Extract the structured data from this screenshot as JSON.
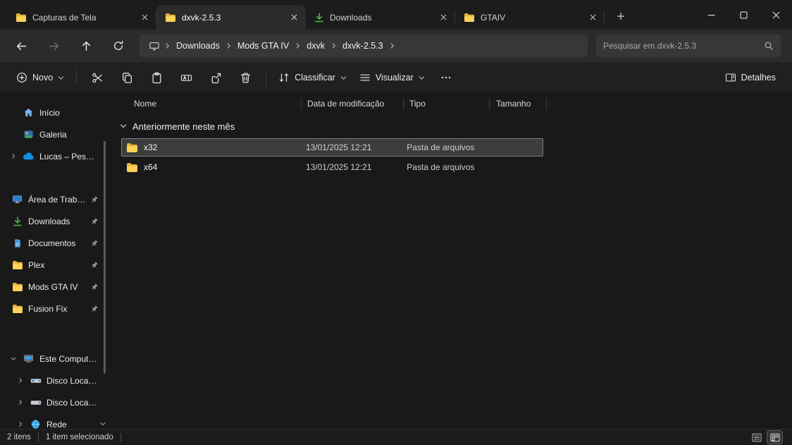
{
  "tabs": [
    {
      "label": "Capturas de Tela",
      "icon": "folder-icon"
    },
    {
      "label": "dxvk-2.5.3",
      "icon": "folder-icon",
      "active": true
    },
    {
      "label": "Downloads",
      "icon": "download-icon"
    },
    {
      "label": "GTAIV",
      "icon": "folder-icon"
    }
  ],
  "navigation": {
    "breadcrumb": [
      "Downloads",
      "Mods GTA IV",
      "dxvk",
      "dxvk-2.5.3"
    ],
    "search_placeholder": "Pesquisar em dxvk-2.5.3"
  },
  "toolbar": {
    "new_label": "Novo",
    "sort_label": "Classificar",
    "view_label": "Visualizar",
    "details_label": "Detalhes"
  },
  "sidebar": {
    "items": [
      {
        "label": "Início",
        "icon": "home-icon"
      },
      {
        "label": "Galeria",
        "icon": "gallery-icon"
      },
      {
        "label": "Lucas – Pessoal",
        "icon": "onedrive-cloud-icon"
      },
      {
        "label": "Área de Trabalho",
        "icon": "desktop-icon",
        "pinned": true
      },
      {
        "label": "Downloads",
        "icon": "download-icon",
        "pinned": true
      },
      {
        "label": "Documentos",
        "icon": "document-icon",
        "pinned": true
      },
      {
        "label": "Plex",
        "icon": "folder-icon",
        "pinned": true
      },
      {
        "label": "Mods GTA IV",
        "icon": "folder-icon",
        "pinned": true
      },
      {
        "label": "Fusion Fix",
        "icon": "folder-icon",
        "pinned": true
      },
      {
        "label": "Este Computador",
        "icon": "computer-icon"
      },
      {
        "label": "Disco Local (C:)",
        "icon": "drive-windows-icon"
      },
      {
        "label": "Disco Local (D:)",
        "icon": "drive-icon"
      },
      {
        "label": "Rede",
        "icon": "network-icon"
      }
    ]
  },
  "files": {
    "columns": [
      "Nome",
      "Data de modificação",
      "Tipo",
      "Tamanho"
    ],
    "group_label": "Anteriormente neste mês",
    "rows": [
      {
        "name": "x32",
        "modified": "13/01/2025 12:21",
        "type": "Pasta de arquivos",
        "size": "",
        "selected": true
      },
      {
        "name": "x64",
        "modified": "13/01/2025 12:21",
        "type": "Pasta de arquivos",
        "size": "",
        "selected": false
      }
    ]
  },
  "statusbar": {
    "item_count": "2 itens",
    "selection": "1 item selecionado"
  },
  "colors": {
    "folder_yellow": "#ffd158",
    "download_green": "#4dc247",
    "accent_blue": "#1490df"
  }
}
